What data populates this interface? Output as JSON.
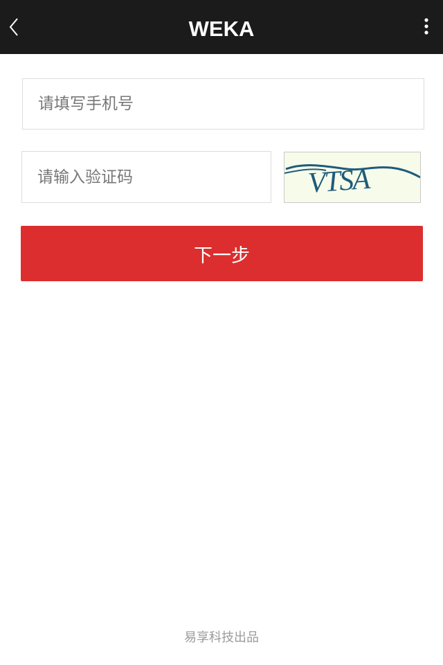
{
  "header": {
    "title": "WEKA",
    "back_icon": "chevron-left-icon",
    "menu_icon": "more-vertical-icon",
    "background": "#1b1b1b"
  },
  "form": {
    "phone_placeholder": "请填写手机号",
    "phone_value": "",
    "code_placeholder": "请输入验证码",
    "code_value": "",
    "captcha_text": "VTSA",
    "captcha_color": "#1e5b7a",
    "next_label": "下一步",
    "next_color": "#dc2e2e"
  },
  "footer": {
    "text": "易享科技出品"
  }
}
